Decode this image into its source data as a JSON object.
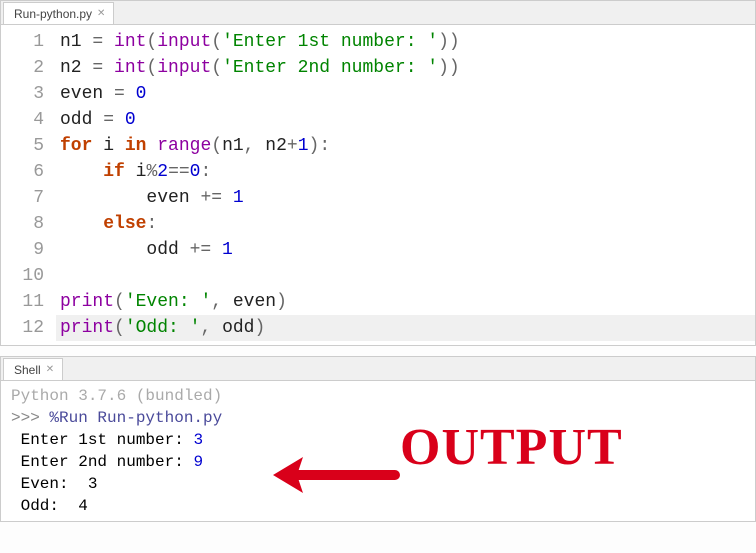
{
  "editor": {
    "tab_label": "Run-python.py",
    "lines": [
      {
        "num": "1",
        "hl": false,
        "tokens": [
          {
            "t": "name",
            "v": "n1 "
          },
          {
            "t": "op",
            "v": "= "
          },
          {
            "t": "builtin",
            "v": "int"
          },
          {
            "t": "paren",
            "v": "("
          },
          {
            "t": "builtin",
            "v": "input"
          },
          {
            "t": "paren",
            "v": "("
          },
          {
            "t": "str",
            "v": "'Enter 1st number: '"
          },
          {
            "t": "paren",
            "v": "))"
          }
        ]
      },
      {
        "num": "2",
        "hl": false,
        "tokens": [
          {
            "t": "name",
            "v": "n2 "
          },
          {
            "t": "op",
            "v": "= "
          },
          {
            "t": "builtin",
            "v": "int"
          },
          {
            "t": "paren",
            "v": "("
          },
          {
            "t": "builtin",
            "v": "input"
          },
          {
            "t": "paren",
            "v": "("
          },
          {
            "t": "str",
            "v": "'Enter 2nd number: '"
          },
          {
            "t": "paren",
            "v": "))"
          }
        ]
      },
      {
        "num": "3",
        "hl": false,
        "tokens": [
          {
            "t": "name",
            "v": "even "
          },
          {
            "t": "op",
            "v": "= "
          },
          {
            "t": "num",
            "v": "0"
          }
        ]
      },
      {
        "num": "4",
        "hl": false,
        "tokens": [
          {
            "t": "name",
            "v": "odd "
          },
          {
            "t": "op",
            "v": "= "
          },
          {
            "t": "num",
            "v": "0"
          }
        ]
      },
      {
        "num": "5",
        "hl": false,
        "tokens": [
          {
            "t": "kw",
            "v": "for"
          },
          {
            "t": "name",
            "v": " i "
          },
          {
            "t": "kw",
            "v": "in"
          },
          {
            "t": "name",
            "v": " "
          },
          {
            "t": "builtin",
            "v": "range"
          },
          {
            "t": "paren",
            "v": "("
          },
          {
            "t": "name",
            "v": "n1"
          },
          {
            "t": "op",
            "v": ", "
          },
          {
            "t": "name",
            "v": "n2"
          },
          {
            "t": "op",
            "v": "+"
          },
          {
            "t": "num",
            "v": "1"
          },
          {
            "t": "paren",
            "v": ")"
          },
          {
            "t": "op",
            "v": ":"
          }
        ]
      },
      {
        "num": "6",
        "hl": false,
        "tokens": [
          {
            "t": "name",
            "v": "    "
          },
          {
            "t": "kw",
            "v": "if"
          },
          {
            "t": "name",
            "v": " i"
          },
          {
            "t": "op",
            "v": "%"
          },
          {
            "t": "num",
            "v": "2"
          },
          {
            "t": "op",
            "v": "=="
          },
          {
            "t": "num",
            "v": "0"
          },
          {
            "t": "op",
            "v": ":"
          }
        ]
      },
      {
        "num": "7",
        "hl": false,
        "tokens": [
          {
            "t": "name",
            "v": "        even "
          },
          {
            "t": "op",
            "v": "+= "
          },
          {
            "t": "num",
            "v": "1"
          }
        ]
      },
      {
        "num": "8",
        "hl": false,
        "tokens": [
          {
            "t": "name",
            "v": "    "
          },
          {
            "t": "kw",
            "v": "else"
          },
          {
            "t": "op",
            "v": ":"
          }
        ]
      },
      {
        "num": "9",
        "hl": false,
        "tokens": [
          {
            "t": "name",
            "v": "        odd "
          },
          {
            "t": "op",
            "v": "+= "
          },
          {
            "t": "num",
            "v": "1"
          }
        ]
      },
      {
        "num": "10",
        "hl": false,
        "tokens": []
      },
      {
        "num": "11",
        "hl": false,
        "tokens": [
          {
            "t": "builtin",
            "v": "print"
          },
          {
            "t": "paren",
            "v": "("
          },
          {
            "t": "str",
            "v": "'Even: '"
          },
          {
            "t": "op",
            "v": ", "
          },
          {
            "t": "name",
            "v": "even"
          },
          {
            "t": "paren",
            "v": ")"
          }
        ]
      },
      {
        "num": "12",
        "hl": true,
        "tokens": [
          {
            "t": "builtin",
            "v": "print"
          },
          {
            "t": "paren",
            "v": "("
          },
          {
            "t": "str",
            "v": "'Odd: '"
          },
          {
            "t": "op",
            "v": ", "
          },
          {
            "t": "name",
            "v": "odd"
          },
          {
            "t": "paren",
            "v": ")"
          }
        ]
      }
    ]
  },
  "shell": {
    "tab_label": "Shell",
    "version_line": "Python 3.7.6 (bundled)",
    "prompt": ">>> ",
    "run_cmd": "%Run Run-python.py",
    "output": [
      {
        "pre": " Enter 1st number: ",
        "num": "3"
      },
      {
        "pre": " Enter 2nd number: ",
        "num": "9"
      },
      {
        "pre": " Even:  3",
        "num": ""
      },
      {
        "pre": " Odd:  4",
        "num": ""
      }
    ]
  },
  "annotation": {
    "text": "OUTPUT"
  }
}
